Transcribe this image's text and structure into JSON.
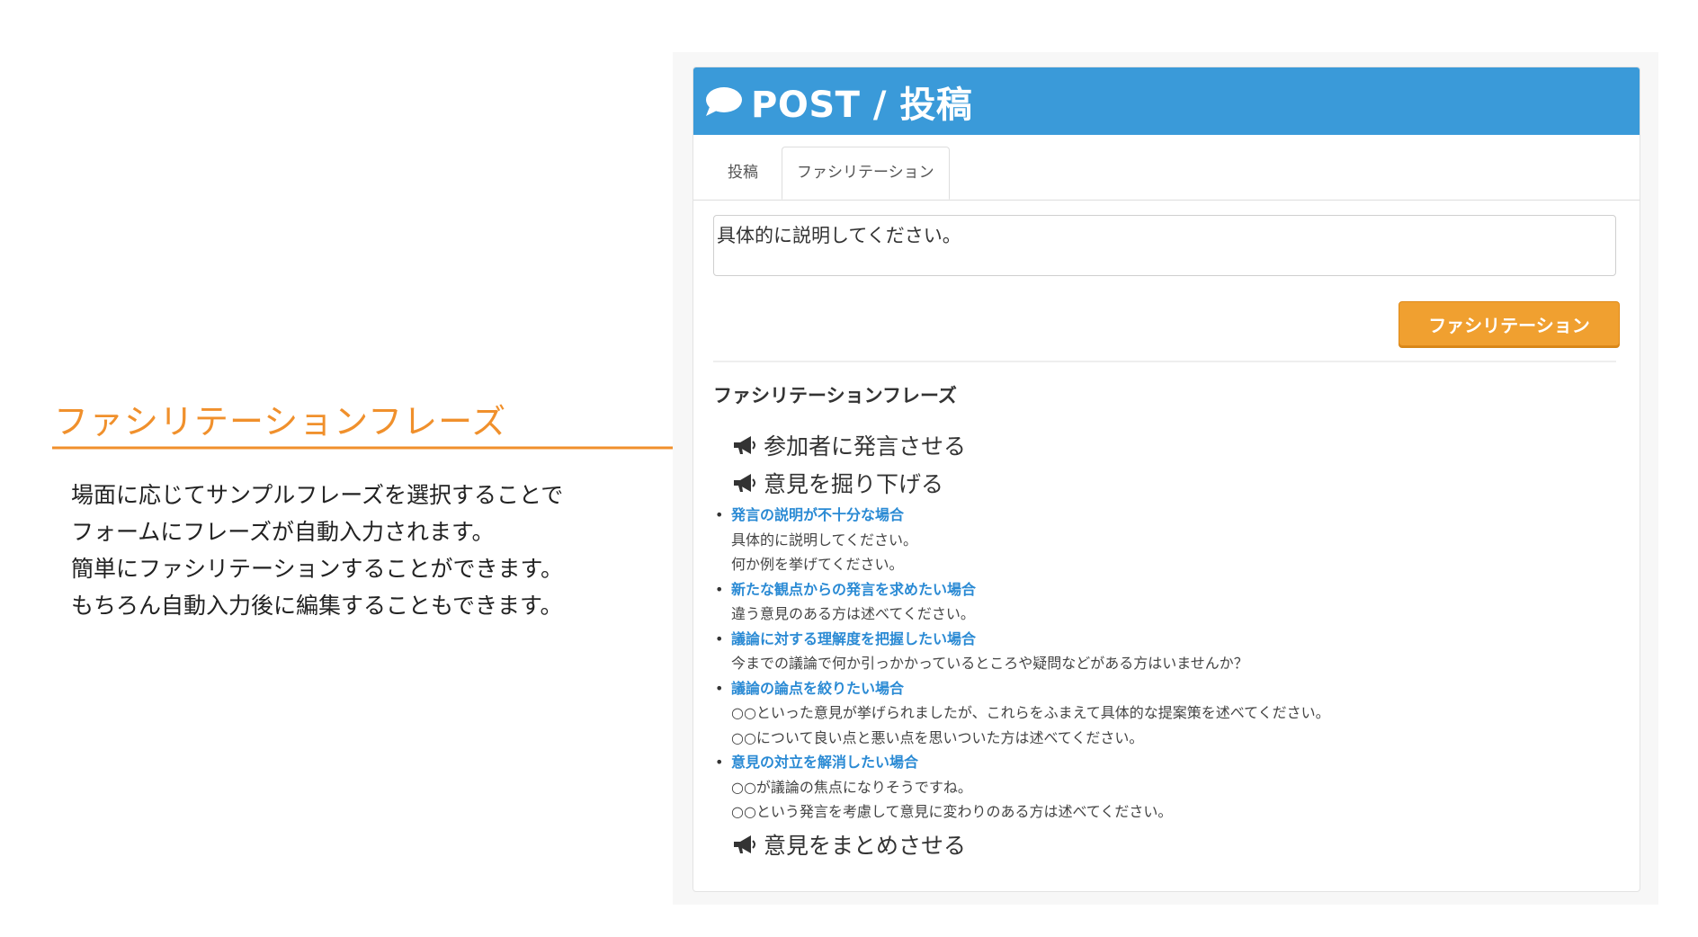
{
  "annotation": {
    "title": "ファシリテーションフレーズ",
    "description": [
      "場面に応じてサンプルフレーズを選択することで",
      "フォームにフレーズが自動入力されます。",
      "簡単にファシリテーションすることができます。",
      "もちろん自動入力後に編集することもできます。"
    ],
    "arrow_color": "#f0902c"
  },
  "panel": {
    "header_icon": "comment-icon",
    "header_title": "POST / 投稿",
    "header_color": "#3a9ad9",
    "tabs": [
      {
        "label": "投稿",
        "active": false
      },
      {
        "label": "ファシリテーション",
        "active": true
      }
    ],
    "textarea_value": "具体的に説明してください。",
    "submit_button": "ファシリテーション",
    "button_color": "#f0a030",
    "phrases_heading": "ファシリテーションフレーズ",
    "groups": [
      {
        "icon": "megaphone-icon",
        "label": "参加者に発言させる"
      },
      {
        "icon": "megaphone-icon",
        "label": "意見を掘り下げる"
      },
      {
        "icon": "megaphone-icon",
        "label": "意見をまとめさせる"
      }
    ],
    "situations": [
      {
        "label": "発言の説明が不十分な場合",
        "examples": [
          "具体的に説明してください。",
          "何か例を挙げてください。"
        ]
      },
      {
        "label": "新たな観点からの発言を求めたい場合",
        "examples": [
          "違う意見のある方は述べてください。"
        ]
      },
      {
        "label": "議論に対する理解度を把握したい場合",
        "examples": [
          "今までの議論で何か引っかかっているところや疑問などがある方はいませんか？"
        ]
      },
      {
        "label": "議論の論点を絞りたい場合",
        "examples": [
          "○○といった意見が挙げられましたが、これらをふまえて具体的な提案策を述べてください。",
          "○○について良い点と悪い点を思いついた方は述べてください。"
        ]
      },
      {
        "label": "意見の対立を解消したい場合",
        "examples": [
          "○○が議論の焦点になりそうですね。",
          "○○という発言を考慮して意見に変わりのある方は述べてください。"
        ]
      }
    ]
  }
}
